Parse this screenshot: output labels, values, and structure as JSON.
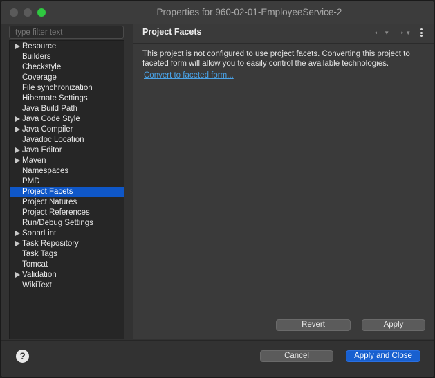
{
  "window": {
    "title": "Properties for 960-02-01-EmployeeService-2"
  },
  "filter": {
    "placeholder": "type filter text"
  },
  "tree": {
    "items": [
      {
        "label": "Resource",
        "expandable": true
      },
      {
        "label": "Builders",
        "expandable": false
      },
      {
        "label": "Checkstyle",
        "expandable": false
      },
      {
        "label": "Coverage",
        "expandable": false
      },
      {
        "label": "File synchronization",
        "expandable": false
      },
      {
        "label": "Hibernate Settings",
        "expandable": false
      },
      {
        "label": "Java Build Path",
        "expandable": false
      },
      {
        "label": "Java Code Style",
        "expandable": true
      },
      {
        "label": "Java Compiler",
        "expandable": true
      },
      {
        "label": "Javadoc Location",
        "expandable": false
      },
      {
        "label": "Java Editor",
        "expandable": true
      },
      {
        "label": "Maven",
        "expandable": true
      },
      {
        "label": "Namespaces",
        "expandable": false
      },
      {
        "label": "PMD",
        "expandable": false
      },
      {
        "label": "Project Facets",
        "expandable": false,
        "selected": true
      },
      {
        "label": "Project Natures",
        "expandable": false
      },
      {
        "label": "Project References",
        "expandable": false
      },
      {
        "label": "Run/Debug Settings",
        "expandable": false
      },
      {
        "label": "SonarLint",
        "expandable": true
      },
      {
        "label": "Task Repository",
        "expandable": true
      },
      {
        "label": "Task Tags",
        "expandable": false
      },
      {
        "label": "Tomcat",
        "expandable": false
      },
      {
        "label": "Validation",
        "expandable": true
      },
      {
        "label": "WikiText",
        "expandable": false
      }
    ]
  },
  "page": {
    "title": "Project Facets",
    "description": "This project is not configured to use project facets. Converting this project to faceted form will allow you to easily control the available technologies.",
    "link": "Convert to faceted form...",
    "revert_label": "Revert",
    "apply_label": "Apply"
  },
  "footer": {
    "help_icon": "?",
    "cancel_label": "Cancel",
    "apply_close_label": "Apply and Close"
  },
  "colors": {
    "selection": "#0f57c8",
    "link": "#4aa3e8",
    "primary_button": "#1860d0"
  }
}
